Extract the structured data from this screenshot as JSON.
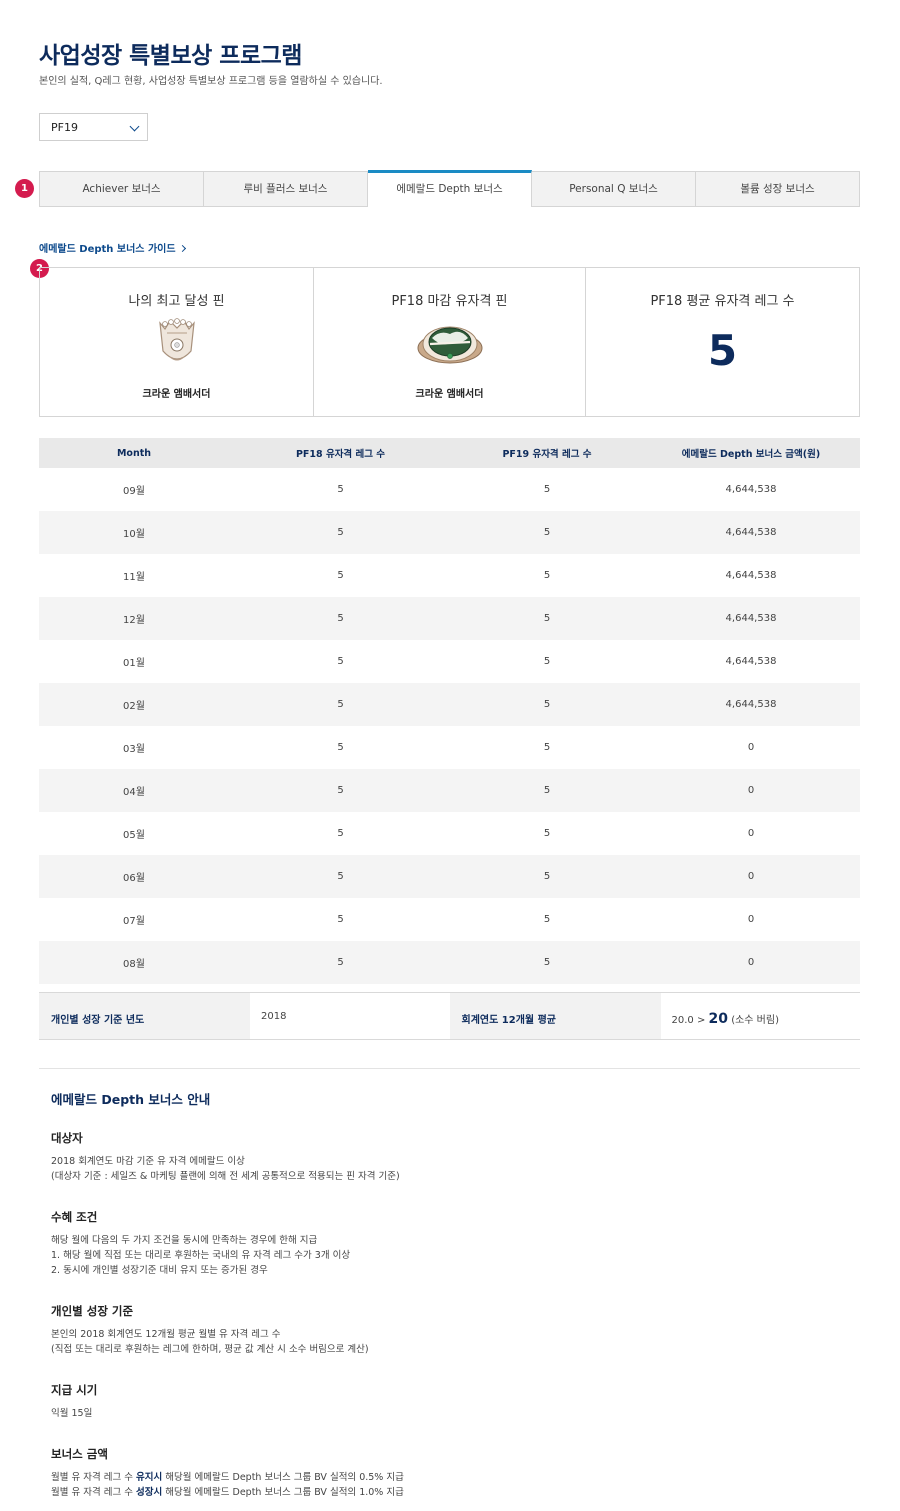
{
  "header": {
    "title": "사업성장 특별보상 프로그램",
    "description": "본인의 실적, Q레그 현황, 사업성장 특별보상 프로그램 등을 열람하실 수 있습니다."
  },
  "period_select": {
    "selected": "PF19"
  },
  "badges": {
    "tabs": "1",
    "pins": "2"
  },
  "tabs": [
    {
      "label": "Achiever 보너스",
      "active": false
    },
    {
      "label": "루비 플러스 보너스",
      "active": false
    },
    {
      "label": "에메랄드 Depth 보너스",
      "active": true
    },
    {
      "label": "Personal Q 보너스",
      "active": false
    },
    {
      "label": "볼륨 성장 보너스",
      "active": false
    }
  ],
  "guide_link": "에메랄드 Depth 보너스 가이드",
  "pins": {
    "best": {
      "title": "나의 최고 달성 핀",
      "name": "크라운 앰배서더"
    },
    "closing": {
      "title": "PF18 마감 유자격 핀",
      "name": "크라운 앰배서더"
    },
    "average": {
      "title": "PF18 평균 유자격 레그 수",
      "value": "5"
    }
  },
  "table": {
    "headers": [
      "Month",
      "PF18 유자격 레그 수",
      "PF19 유자격 레그 수",
      "에메랄드 Depth 보너스 금액(원)"
    ],
    "rows": [
      [
        "09월",
        "5",
        "5",
        "4,644,538"
      ],
      [
        "10월",
        "5",
        "5",
        "4,644,538"
      ],
      [
        "11월",
        "5",
        "5",
        "4,644,538"
      ],
      [
        "12월",
        "5",
        "5",
        "4,644,538"
      ],
      [
        "01월",
        "5",
        "5",
        "4,644,538"
      ],
      [
        "02월",
        "5",
        "5",
        "4,644,538"
      ],
      [
        "03월",
        "5",
        "5",
        "0"
      ],
      [
        "04월",
        "5",
        "5",
        "0"
      ],
      [
        "05월",
        "5",
        "5",
        "0"
      ],
      [
        "06월",
        "5",
        "5",
        "0"
      ],
      [
        "07월",
        "5",
        "5",
        "0"
      ],
      [
        "08월",
        "5",
        "5",
        "0"
      ]
    ]
  },
  "summary": {
    "base_year_label": "개인별 성장 기준 년도",
    "base_year_value": "2018",
    "avg_label": "회계연도 12개월 평균",
    "avg_raw": "20.0 >",
    "avg_big": "20",
    "avg_note": "(소수 버림)"
  },
  "info": {
    "title": "에메랄드 Depth 보너스 안내",
    "sections": [
      {
        "head": "대상자",
        "lines": [
          "2018 회계연도 마감 기준 유 자격 에메랄드 이상",
          "(대상자 기준 : 세일즈 & 마케팅 플랜에 의해 전 세계 공통적으로 적용되는 핀 자격 기준)"
        ]
      },
      {
        "head": "수혜 조건",
        "lines": [
          "해당 월에 다음의 두 가지 조건을 동시에 만족하는 경우에 한해 지급",
          "1. 해당 월에 직접 또는 대리로 후원하는 국내의 유 자격 레그 수가 3개 이상",
          "2. 동시에 개인별 성장기준 대비 유지 또는 증가된 경우"
        ]
      },
      {
        "head": "개인별 성장 기준",
        "lines": [
          "본인의 2018 회계연도 12개월 평균 월별 유 자격 레그 수",
          "(직접 또는 대리로 후원하는 레그에 한하며, 평균 값 계산 시 소수 버림으로 계산)"
        ]
      },
      {
        "head": "지급 시기",
        "lines": [
          "익월 15일"
        ]
      }
    ],
    "amount": {
      "head": "보너스 금액",
      "line1_pre": "월별 유 자격 레그 수",
      "line1_bold": "유지시",
      "line1_post": "해당월 에메랄드 Depth 보너스 그룹 BV 실적의 0.5% 지급",
      "line2_pre": "월별 유 자격 레그 수",
      "line2_bold": "성장시",
      "line2_post": "해당월 에메랄드 Depth 보너스 그룹 BV 실적의 1.0% 지급"
    }
  }
}
